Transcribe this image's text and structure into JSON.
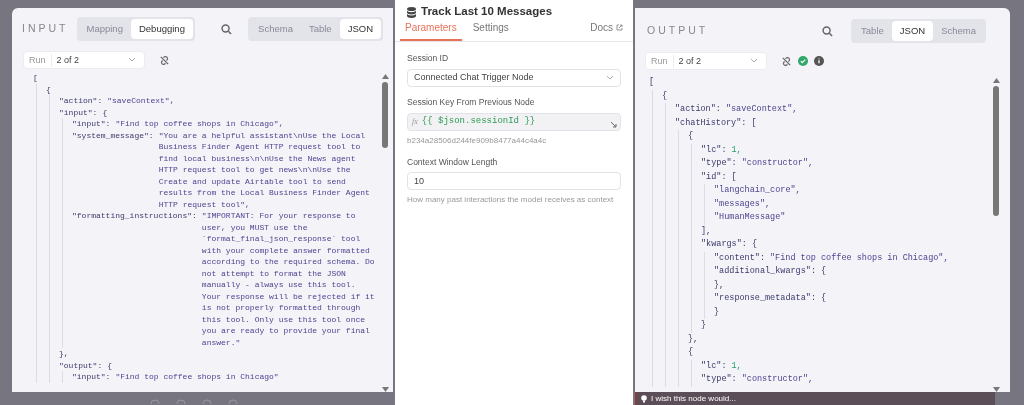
{
  "input_panel": {
    "title": "INPUT",
    "modes": [
      {
        "label": "Mapping",
        "selected": false
      },
      {
        "label": "Debugging",
        "selected": true
      }
    ],
    "views": [
      {
        "label": "Schema",
        "selected": false
      },
      {
        "label": "Table",
        "selected": false
      },
      {
        "label": "JSON",
        "selected": true
      }
    ],
    "run": {
      "label": "Run",
      "value": "2 of 2"
    },
    "json_tree": {
      "open": "[",
      "children": [
        {
          "open": "{",
          "children": [
            {
              "key": "\"action\":",
              "value": "\"saveContext\",",
              "kind": "string"
            },
            {
              "key": "\"input\":",
              "open": "{",
              "children": [
                {
                  "key": "\"input\":",
                  "value": "\"Find top coffee shops in Chicago\",",
                  "kind": "string"
                },
                {
                  "key": "\"system_message\":",
                  "value": "\"You are a helpful assistant\\nUse the Local Business Finder Agent HTTP request tool to find local business\\n\\nUse the News agent HTTP request tool to get news\\n\\nUse the Create and update Airtable tool to send results from the Local Business Finder Agent HTTP request tool\",",
                  "kind": "string"
                },
                {
                  "key": "\"formatting_instructions\":",
                  "value": "\"IMPORTANT: For your response to user, you MUST use the `format_final_json_response` tool with your complete answer formatted according to the required schema. Do not attempt to format the JSON manually - always use this tool. Your response will be rejected if it is not properly formatted through this tool. Only use this tool once you are ready to provide your final answer.\"",
                  "kind": "string"
                }
              ],
              "close": "},"
            },
            {
              "key": "\"output\":",
              "open": "{",
              "children": [
                {
                  "key": "\"input\":",
                  "value": "\"Find top coffee shops in Chicago\"",
                  "kind": "string"
                }
              ]
            }
          ]
        }
      ]
    }
  },
  "node_panel": {
    "title": "Track Last 10 Messages",
    "tabs": [
      {
        "label": "Parameters",
        "selected": true
      },
      {
        "label": "Settings",
        "selected": false
      }
    ],
    "docs_link": "Docs",
    "fields": [
      {
        "kind": "select",
        "label": "Session ID",
        "value": "Connected Chat Trigger Node"
      },
      {
        "kind": "expression",
        "label": "Session Key From Previous Node",
        "prefix": "fx",
        "value": "{{ $json.sessionId }}",
        "hint": "b234a28506d244fe909b8477a44c4a4c"
      },
      {
        "kind": "number",
        "label": "Context Window Length",
        "value": "10",
        "hint": "How many past interactions the model receives as context"
      }
    ]
  },
  "output_panel": {
    "title": "OUTPUT",
    "views": [
      {
        "label": "Table",
        "selected": false
      },
      {
        "label": "JSON",
        "selected": true
      },
      {
        "label": "Schema",
        "selected": false
      }
    ],
    "run": {
      "label": "Run",
      "value": "2 of 2"
    },
    "json_tree": {
      "open": "[",
      "children": [
        {
          "open": "{",
          "children": [
            {
              "key": "\"action\":",
              "value": "\"saveContext\",",
              "kind": "string"
            },
            {
              "key": "\"chatHistory\":",
              "open": "[",
              "children": [
                {
                  "open": "{",
                  "children": [
                    {
                      "key": "\"lc\":",
                      "value": "1,",
                      "kind": "number"
                    },
                    {
                      "key": "\"type\":",
                      "value": "\"constructor\",",
                      "kind": "string"
                    },
                    {
                      "key": "\"id\":",
                      "open": "[",
                      "children": [
                        {
                          "value": "\"langchain_core\",",
                          "kind": "string"
                        },
                        {
                          "value": "\"messages\",",
                          "kind": "string"
                        },
                        {
                          "value": "\"HumanMessage\"",
                          "kind": "string"
                        }
                      ],
                      "close": "],"
                    },
                    {
                      "key": "\"kwargs\":",
                      "open": "{",
                      "children": [
                        {
                          "key": "\"content\":",
                          "value": "\"Find top coffee shops in Chicago\",",
                          "kind": "string"
                        },
                        {
                          "key": "\"additional_kwargs\":",
                          "open": "{",
                          "close": "},"
                        },
                        {
                          "key": "\"response_metadata\":",
                          "open": "{",
                          "close": "}"
                        }
                      ],
                      "close": "}"
                    }
                  ],
                  "close": "},"
                },
                {
                  "open": "{",
                  "children": [
                    {
                      "key": "\"lc\":",
                      "value": "1,",
                      "kind": "number"
                    },
                    {
                      "key": "\"type\":",
                      "value": "\"constructor\",",
                      "kind": "string"
                    }
                  ]
                }
              ]
            }
          ]
        }
      ]
    }
  },
  "feedback": {
    "placeholder": "I wish this node would..."
  }
}
